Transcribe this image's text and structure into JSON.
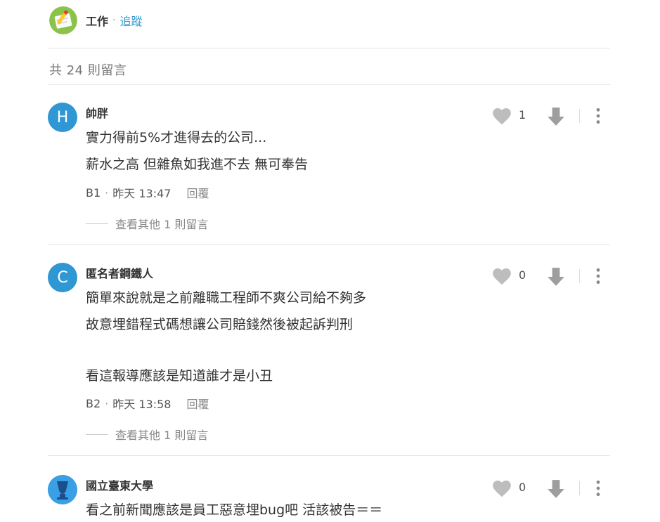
{
  "board": {
    "name": "工作",
    "separator": "·",
    "follow_label": "追蹤",
    "icon": "work-board-icon"
  },
  "comment_count": "共 24 則留言",
  "comments": [
    {
      "avatar_letter": "H",
      "author": "帥胖",
      "lines": [
        "實力得前5%才進得去的公司...",
        "薪水之高 但雜魚如我進不去 無可奉告"
      ],
      "floor": "B1",
      "time": "昨天 13:47",
      "reply_label": "回覆",
      "likes": "1",
      "more_label": "查看其他 1 則留言"
    },
    {
      "avatar_letter": "C",
      "author": "匿名者鋼鐵人",
      "lines": [
        "簡單來說就是之前離職工程師不爽公司給不夠多",
        "故意埋錯程式碼想讓公司賠錢然後被起訴判刑",
        "",
        "看這報導應該是知道誰才是小丑"
      ],
      "floor": "B2",
      "time": "昨天 13:58",
      "reply_label": "回覆",
      "likes": "0",
      "more_label": "查看其他 1 則留言"
    },
    {
      "avatar_icon": "university-icon",
      "author": "國立臺東大學",
      "lines": [
        "看之前新聞應該是員工惡意埋bug吧 活該被告＝＝"
      ],
      "likes": "0"
    }
  ],
  "colors": {
    "accent": "#3397cf",
    "avatar": "#2f97d3",
    "icon_gray": "#bdbdbd"
  }
}
